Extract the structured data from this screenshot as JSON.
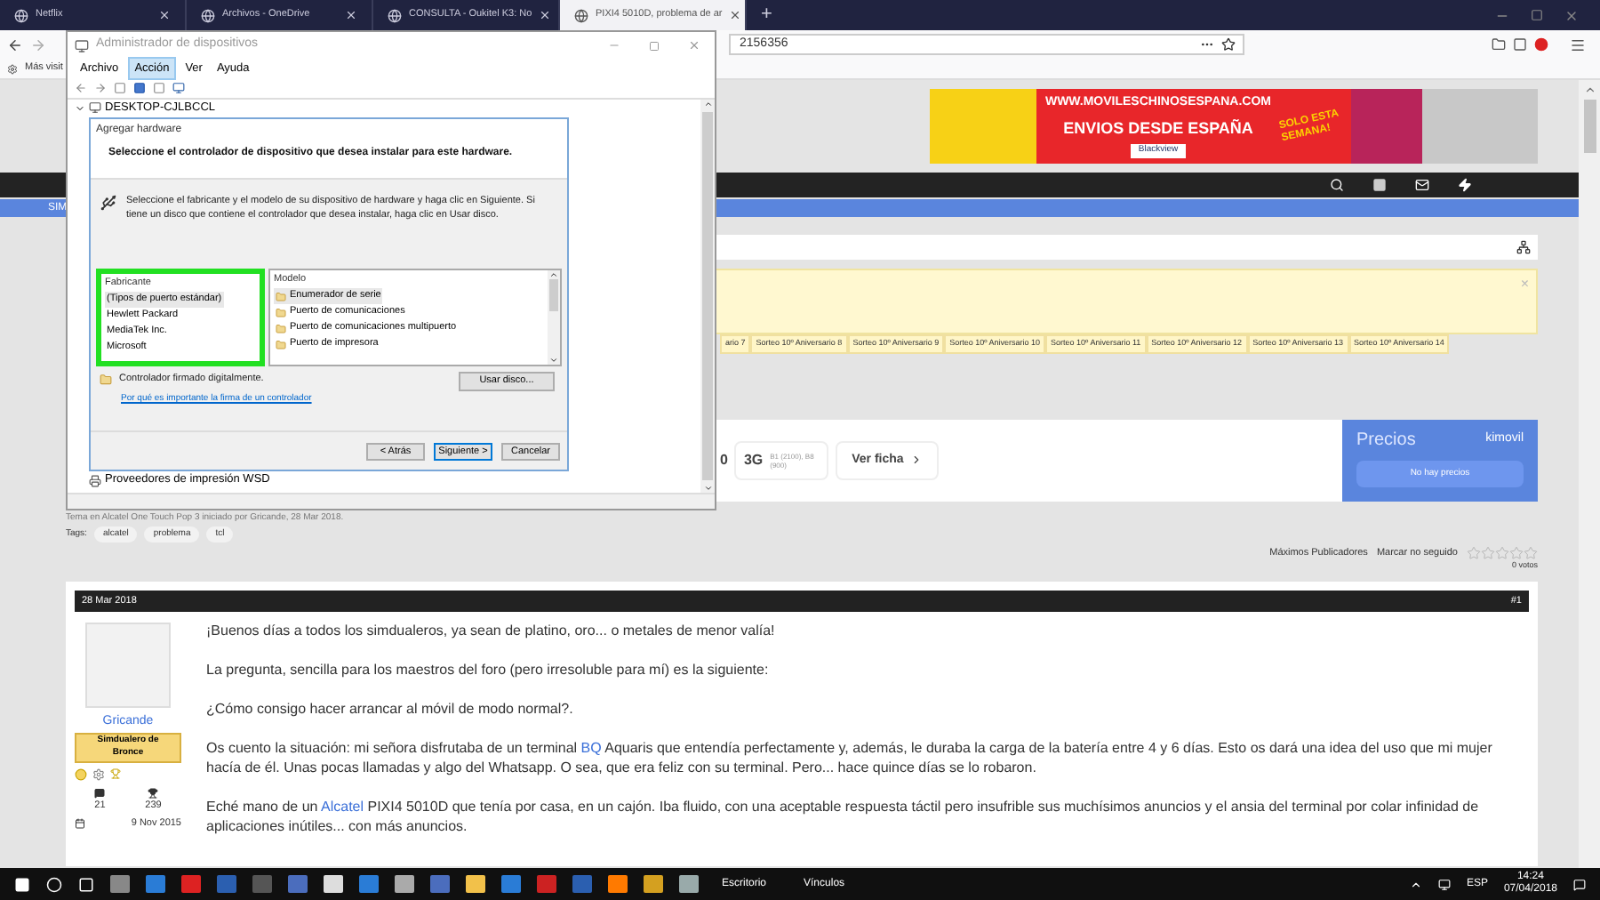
{
  "browser": {
    "tabs": [
      {
        "label": "Netflix",
        "selected": false
      },
      {
        "label": "Archivos - OneDrive",
        "selected": false
      },
      {
        "label": "CONSULTA - Oukitel K3: No",
        "selected": false
      },
      {
        "label": "PIXI4 5010D, problema de ar",
        "selected": true
      }
    ],
    "new_tab": "+",
    "address": "2156356",
    "bookmark": "Más visit"
  },
  "banner": {
    "site": "WWW.MOVILESCHINOSESPANA.COM",
    "headline": "ENVIOS DESDE ESPAÑA",
    "promo": "SOLO ESTA SEMANA!",
    "brand": "Blackview"
  },
  "nav": {
    "section": "SIM"
  },
  "notice": {
    "close": "×",
    "tags": [
      "ario 7",
      "Sorteo 10º Aniversario 8",
      "Sorteo 10º Aniversario 9",
      "Sorteo 10º Aniversario 10",
      "Sorteo 10º Aniversario 11",
      "Sorteo 10º Aniversario 12",
      "Sorteo 10º Aniversario 13",
      "Sorteo 10º Aniversario 14"
    ]
  },
  "phone_card": {
    "partial": "0",
    "network": "3G",
    "bands": "B1 (2100), B8 (900)",
    "details_link": "Ver ficha",
    "prices_title": "Precios",
    "prices_brand": "kimovil",
    "prices_status": "No hay precios"
  },
  "thread": {
    "started": "Tema en Alcatel One Touch Pop 3 iniciado por Gricande, 28 Mar 2018.",
    "tags_label": "Tags:",
    "tags": [
      "alcatel",
      "problema",
      "tcl"
    ],
    "actions": [
      "Máximos Publicadores",
      "Marcar no seguido"
    ],
    "stars": 0,
    "votes": "0 votos"
  },
  "post": {
    "date": "28 Mar 2018",
    "number": "#1",
    "author": "Gricande",
    "rank": "Simdualero de Bronce",
    "messages": "21",
    "likes": "239",
    "joined": "9 Nov 2015",
    "paragraphs": [
      "¡Buenos días a todos los simdualeros, ya sean de platino, oro... o metales de menor valía!",
      "La pregunta, sencilla para los maestros del foro (pero irresoluble para mí) es la siguiente:",
      "¿Cómo consigo hacer arrancar al móvil de modo normal?.",
      "Os cuento la situación: mi señora disfrutaba de un terminal ",
      "Eché mano de un "
    ]
  },
  "paragraph_links": [
    {
      "link": "BQ",
      "rest": " Aquaris que entendía perfectamente y, además, le duraba la carga de la batería entre 4 y 6 días. Esto os dará una idea del uso que mi mujer hacía de él. Unas pocas llamadas y algo del Whatsapp. O sea, que era feliz con su terminal. Pero... hace quince días se lo robaron."
    },
    {
      "link": "Alcatel",
      "rest": " PIXI4 5010D que tenía por casa, en un cajón. Iba fluido, con una aceptable respuesta táctil pero insufrible sus muchísimos anuncios y el ansia del terminal por colar infinidad de aplicaciones inútiles... con más anuncios."
    }
  ],
  "device_manager": {
    "title": "Administrador de dispositivos",
    "menu": [
      {
        "label": "Archivo",
        "selected": false
      },
      {
        "label": "Acción",
        "selected": true
      },
      {
        "label": "Ver",
        "selected": false
      },
      {
        "label": "Ayuda",
        "selected": false
      }
    ],
    "tree": [
      {
        "label": "DESKTOP-CJLBCCL",
        "expanded": true
      }
    ],
    "tree_bottom": "Proveedores de impresión WSD"
  },
  "add_hardware": {
    "title": "Agregar hardware",
    "heading": "Seleccione el controlador de dispositivo que desea instalar para este hardware.",
    "description": "Seleccione el fabricante y el modelo de su dispositivo de hardware y haga clic en Siguiente. Si tiene un disco que contiene el controlador que desea instalar, haga clic en  Usar disco.",
    "manufacturer_header": "Fabricante",
    "manufacturers": [
      {
        "label": "(Tipos de puerto estándar)",
        "selected": true
      },
      {
        "label": "Hewlett Packard",
        "selected": false
      },
      {
        "label": "MediaTek Inc.",
        "selected": false
      },
      {
        "label": "Microsoft",
        "selected": false
      }
    ],
    "model_header": "Modelo",
    "models": [
      {
        "label": "Enumerador de serie",
        "selected": true
      },
      {
        "label": "Puerto de comunicaciones",
        "selected": false
      },
      {
        "label": "Puerto de comunicaciones multipuerto",
        "selected": false
      },
      {
        "label": "Puerto de impresora",
        "selected": false
      }
    ],
    "signed": "Controlador firmado digitalmente.",
    "signed_link": "Por qué es importante la firma de un controlador",
    "have_disk": "Usar disco...",
    "buttons": [
      "< Atrás",
      "Siguiente >",
      "Cancelar"
    ]
  },
  "taskbar": {
    "toolbar": "Escritorio",
    "links": "Vínculos",
    "language": "ESP",
    "time": "14:24",
    "date": "07/04/2018"
  }
}
